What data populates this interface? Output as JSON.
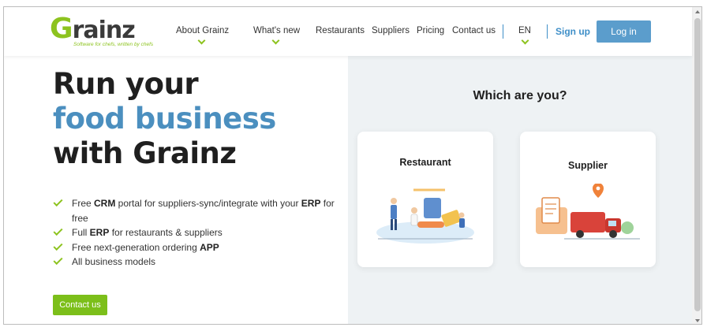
{
  "brand": {
    "name_initial": "G",
    "name_rest": "rainz",
    "tagline": "Software for chefs, written by chefs",
    "accent_color": "#8dc31f",
    "link_color": "#3f8fc8"
  },
  "nav": {
    "about": "About Grainz",
    "whats_new": "What's new",
    "restaurants": "Restaurants",
    "suppliers": "Suppliers",
    "pricing": "Pricing",
    "contact": "Contact us",
    "language": "EN",
    "signup": "Sign up",
    "login": "Log in"
  },
  "hero": {
    "line1": "Run your",
    "line2": "food business",
    "line3": "with Grainz"
  },
  "features": [
    {
      "pre": "Free ",
      "b1": "CRM",
      "mid": " portal for suppliers-sync/integrate with your ",
      "b2": "ERP",
      "post": " for free"
    },
    {
      "pre": "Full ",
      "b1": "ERP",
      "mid": " for restaurants & suppliers",
      "b2": "",
      "post": ""
    },
    {
      "pre": "Free next-generation ordering ",
      "b1": "APP",
      "mid": "",
      "b2": "",
      "post": ""
    },
    {
      "pre": "All business models",
      "b1": "",
      "mid": "",
      "b2": "",
      "post": ""
    }
  ],
  "cta": {
    "contact": "Contact us"
  },
  "chooser": {
    "question": "Which are you?",
    "restaurant": "Restaurant",
    "supplier": "Supplier"
  }
}
